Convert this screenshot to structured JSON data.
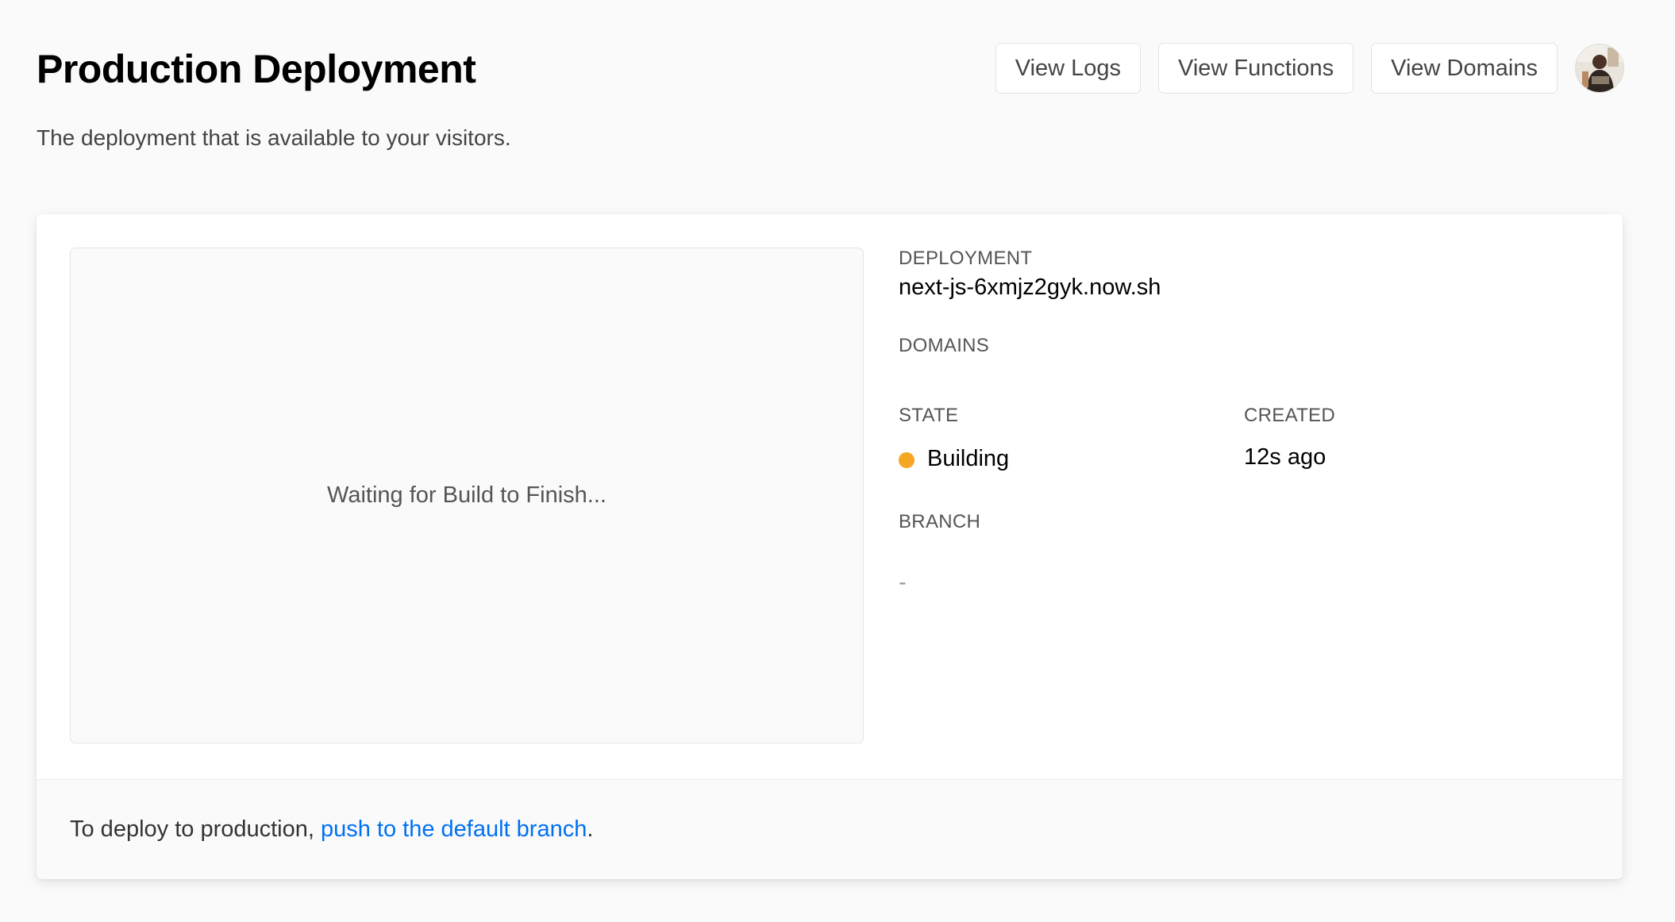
{
  "header": {
    "title": "Production Deployment",
    "subtitle": "The deployment that is available to your visitors."
  },
  "actions": {
    "view_logs": "View Logs",
    "view_functions": "View Functions",
    "view_domains": "View Domains"
  },
  "preview": {
    "status_text": "Waiting for Build to Finish..."
  },
  "details": {
    "deployment_label": "DEPLOYMENT",
    "deployment_value": "next-js-6xmjz2gyk.now.sh",
    "domains_label": "DOMAINS",
    "state_label": "STATE",
    "state_value": "Building",
    "state_color": "#f5a623",
    "created_label": "CREATED",
    "created_value": "12s ago",
    "branch_label": "BRANCH",
    "branch_value": "-"
  },
  "footer": {
    "prefix": "To deploy to production, ",
    "link_text": "push to the default branch",
    "suffix": "."
  },
  "colors": {
    "link": "#0070f3",
    "background": "#fafafa"
  }
}
